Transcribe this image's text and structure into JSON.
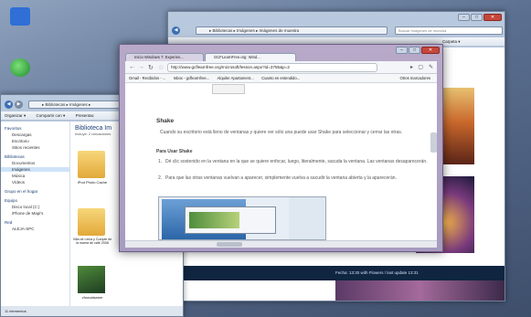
{
  "desktop": {
    "icons": [
      {
        "label": "",
        "color": "#2f6fd6"
      },
      {
        "label": "",
        "color": "#2aa33a"
      }
    ]
  },
  "back_window": {
    "address": "▸ Bibliotecas ▸ Imágenes ▸ Imágenes de muestra",
    "search_placeholder": "Buscar Imágenes de muestra",
    "organize_label": "Organizar ▾",
    "sort_label": "Carpeta ▾",
    "status": "Fecha: 13:30 with Flowers / last update 13:31"
  },
  "explorer": {
    "address": "▸ Bibliotecas ▸ Imágenes ▸",
    "toolbar": [
      "Organizar ▾",
      "Compartir con ▾",
      "Presentac"
    ],
    "library_title": "Biblioteca Im",
    "library_sub": "Incluye: 2 ubicaciones",
    "nav": [
      {
        "group": "Favoritos",
        "items": [
          "Descargas",
          "Escritorio",
          "Sitios recientes"
        ]
      },
      {
        "group": "Bibliotecas",
        "items": [
          "Documentos",
          "Imágenes",
          "Música",
          "Vídeos"
        ]
      },
      {
        "group": "Grupo en el hogar",
        "items": []
      },
      {
        "group": "Equipo",
        "items": [
          "Disco local (C:)",
          "iPhone de Mapi's"
        ]
      },
      {
        "group": "Red",
        "items": [
          "ALEJA-SPC"
        ]
      }
    ],
    "selected_item": "Imágenes",
    "files": [
      {
        "label": "iPod Photo Cache"
      },
      {
        "label": "Villa de Leiva y Cumple de la mamá de cafe 2008"
      },
      {
        "label": "vfoocatsame"
      }
    ],
    "status": "11 elementos"
  },
  "browser": {
    "tabs": [
      {
        "label": "Inicio Windows 7: Experien..."
      },
      {
        "label": "GCFLearnFree.org: Wind..."
      }
    ],
    "url": "http://www.gcflearnfree.org/microsoft/lesson.aspx?id=3755&p=2",
    "bookmarks": [
      "Gmail - Recibidos - ...",
      "Inbox - gcflearnfree...",
      "Alquiler Apartament...",
      "Cuanto es entendido...",
      "Otros marcadores"
    ],
    "article": {
      "heading": "Shake",
      "intro": "Cuando su escritorio está lleno de ventanas y quiere ver sólo una puede usar Shake para seleccionar y cerrar las otras.",
      "subheading": "Para Usar Shake",
      "steps": [
        "Dé clic sostenido en la ventana en la que se quiere enfocar, luego, literalmente, sacuda la ventana. Las ventanas desaparecerán.",
        "Para que las otras ventanas vuelvan a aparecer, simplemente vuelva a sacudir la ventana abierta y la aparecerán."
      ]
    }
  }
}
